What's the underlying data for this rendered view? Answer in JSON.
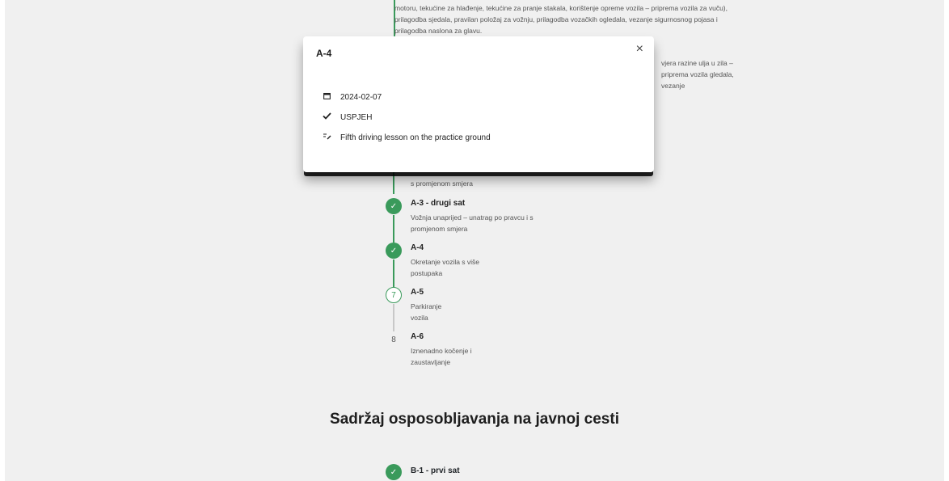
{
  "background_text": {
    "top_paragraph": "motoru, tekućine za hlađenje, tekućine za pranje stakala, korištenje opreme vozila – priprema vozila za vuču), prilagodba sjedala, pravilan položaj za vožnju, prilagodba vozačkih ogledala, vezanje sigurnosnog pojasa i prilagodba naslona za glavu.",
    "hidden_paragraph": "vjera razine ulja u zila – priprema vozila gledala, vezanje",
    "pre_desc": "s promjenom smjera"
  },
  "timeline": [
    {
      "marker": "✓",
      "state": "done",
      "title": "A-3 - drugi sat",
      "desc": "Vožnja unaprijed – unatrag po pravcu i s promjenom smjera"
    },
    {
      "marker": "✓",
      "state": "done",
      "title": "A-4",
      "desc": "Okretanje vozila s više postupaka"
    },
    {
      "marker": "7",
      "state": "current",
      "title": "A-5",
      "desc": "Parkiranje vozila"
    },
    {
      "marker": "8",
      "state": "pending",
      "title": "A-6",
      "desc": "Iznenadno kočenje i zaustavljanje"
    }
  ],
  "section_title": "Sadržaj osposobljavanja na javnoj cesti",
  "b1": {
    "marker": "✓",
    "title": "B-1 - prvi sat"
  },
  "modal": {
    "title": "A-4",
    "close_icon": "×",
    "date": "2024-02-07",
    "result": "USPJEH",
    "note": "Fifth driving lesson on the practice ground",
    "accent": "#3a9a5b"
  }
}
